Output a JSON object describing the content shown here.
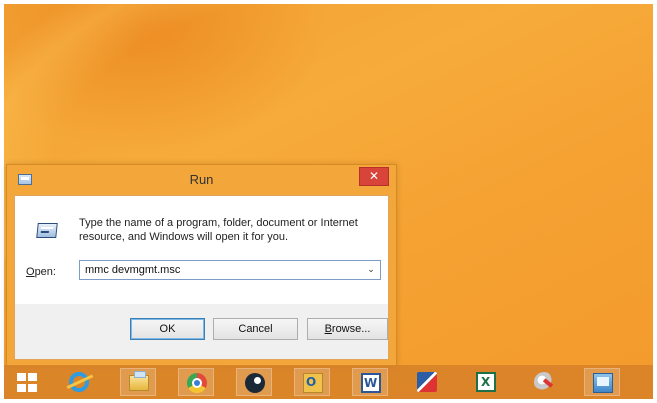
{
  "run_dialog": {
    "title": "Run",
    "close_glyph": "✕",
    "description": "Type the name of a program, folder, document or Internet resource, and Windows will open it for you.",
    "open_label_accel": "O",
    "open_label_rest": "pen:",
    "open_value": "mmc devmgmt.msc",
    "ok_label": "OK",
    "cancel_label": "Cancel",
    "browse_accel": "B",
    "browse_rest": "rowse...",
    "dropdown_glyph": "⌄"
  },
  "taskbar": {
    "items": [
      {
        "icon": "windows-logo-icon"
      },
      {
        "icon": "internet-explorer-icon"
      },
      {
        "icon": "file-explorer-icon"
      },
      {
        "icon": "chrome-icon"
      },
      {
        "icon": "steam-icon"
      },
      {
        "icon": "outlook-icon"
      },
      {
        "icon": "word-icon"
      },
      {
        "icon": "pen-tool-icon"
      },
      {
        "icon": "excel-icon"
      },
      {
        "icon": "tools-icon"
      },
      {
        "icon": "control-panel-icon"
      }
    ]
  },
  "colors": {
    "desktop": "#f5a537",
    "dialog_frame": "#f3a63a",
    "close_button": "#d9443a",
    "taskbar": "#d68028"
  }
}
